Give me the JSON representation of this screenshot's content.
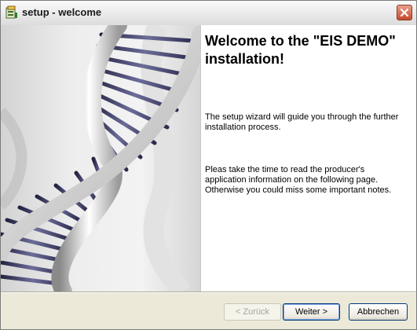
{
  "window": {
    "title": "setup - welcome",
    "icon": "setup-icon",
    "close_icon": "close-icon"
  },
  "content": {
    "image": "dna-helix-image",
    "heading": "Welcome to the \"EIS DEMO\" installation!",
    "paragraph1": "The setup wizard will guide you through the further installation process.",
    "paragraph2": "Pleas take the time to read the producer's application information on the following page. Otherwise you could miss some important notes."
  },
  "buttons": {
    "back": "< Zurück",
    "next": "Weiter >",
    "cancel": "Abbrechen"
  }
}
